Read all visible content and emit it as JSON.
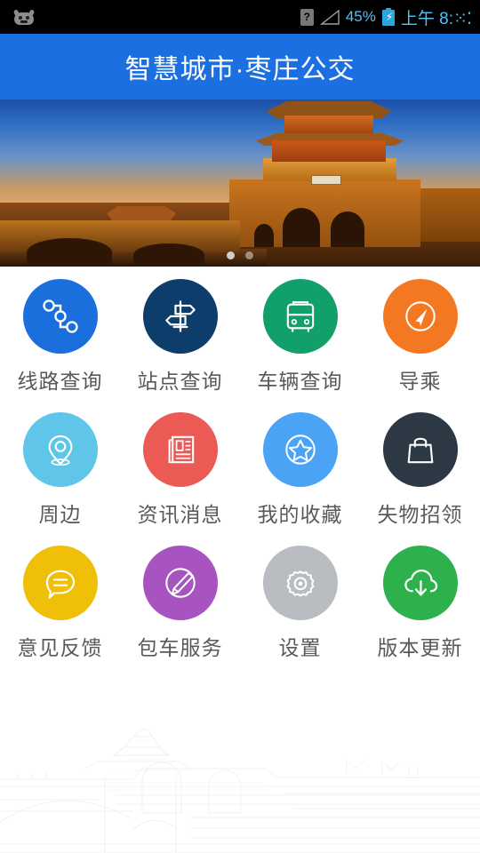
{
  "statusbar": {
    "robot_icon": "android-robot-icon",
    "sim_icon_label": "?",
    "signal_icon": "signal-triangle-icon",
    "battery_percent": "45%",
    "battery_icon": "battery-charging-icon",
    "time_period": "上午",
    "time_value": "8:",
    "time_digits": "⁙⁚"
  },
  "header": {
    "title": "智慧城市·枣庄公交",
    "background_color": "#1c6fe0"
  },
  "banner": {
    "description": "枣庄古城门楼与桥梁夜景",
    "dots": [
      {
        "active": true
      },
      {
        "active": false
      }
    ]
  },
  "grid": {
    "items": [
      {
        "label": "线路查询",
        "icon": "route-nodes-icon",
        "color": "#1b6fdd"
      },
      {
        "label": "站点查询",
        "icon": "signpost-icon",
        "color": "#0c3d6b"
      },
      {
        "label": "车辆查询",
        "icon": "bus-icon",
        "color": "#12a06a"
      },
      {
        "label": "导乘",
        "icon": "navigation-arrow-icon",
        "color": "#f47721"
      },
      {
        "label": "周边",
        "icon": "location-pin-icon",
        "color": "#5fc6ea"
      },
      {
        "label": "资讯消息",
        "icon": "newspaper-icon",
        "color": "#ec5a55"
      },
      {
        "label": "我的收藏",
        "icon": "star-circle-icon",
        "color": "#4aa3f5"
      },
      {
        "label": "失物招领",
        "icon": "handbag-icon",
        "color": "#2d3845"
      },
      {
        "label": "意见反馈",
        "icon": "speech-bubble-icon",
        "color": "#efc007"
      },
      {
        "label": "包车服务",
        "icon": "pencil-circle-icon",
        "color": "#a854c0"
      },
      {
        "label": "设置",
        "icon": "gear-icon",
        "color": "#b9bcc0"
      },
      {
        "label": "版本更新",
        "icon": "cloud-download-icon",
        "color": "#2cb14d"
      }
    ]
  },
  "watermark": {
    "description": "古城门楼线稿水印"
  }
}
